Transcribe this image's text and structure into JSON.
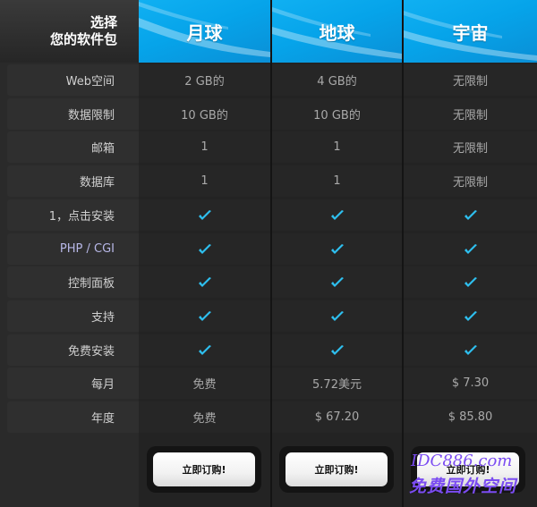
{
  "header": {
    "title_line1": "选择",
    "title_line2": "您的软件包"
  },
  "plans": [
    {
      "name": "月球"
    },
    {
      "name": "地球"
    },
    {
      "name": "宇宙"
    }
  ],
  "rows": [
    {
      "label": "Web空间",
      "values": [
        "2 GB的",
        "4 GB的",
        "无限制"
      ]
    },
    {
      "label": "数据限制",
      "values": [
        "10 GB的",
        "10 GB的",
        "无限制"
      ]
    },
    {
      "label": "邮箱",
      "values": [
        "1",
        "1",
        "无限制"
      ]
    },
    {
      "label": "数据库",
      "values": [
        "1",
        "1",
        "无限制"
      ]
    },
    {
      "label": "1，点击安装",
      "values": [
        "check",
        "check",
        "check"
      ]
    },
    {
      "label": "PHP / CGI",
      "values": [
        "check",
        "check",
        "check"
      ]
    },
    {
      "label": "控制面板",
      "values": [
        "check",
        "check",
        "check"
      ]
    },
    {
      "label": "支持",
      "values": [
        "check",
        "check",
        "check"
      ]
    },
    {
      "label": "免费安装",
      "values": [
        "check",
        "check",
        "check"
      ]
    },
    {
      "label": "每月",
      "values": [
        "免费",
        "5.72美元",
        "$ 7.30"
      ]
    },
    {
      "label": "年度",
      "values": [
        "免费",
        "$ 67.20",
        "$ 85.80"
      ]
    }
  ],
  "order_buttons": [
    {
      "label": "立即订购!"
    },
    {
      "label": "立即订购!"
    },
    {
      "label": "立即订购!"
    }
  ],
  "watermark": {
    "line1": "IDC886.com",
    "line2": "免费国外空间"
  },
  "colors": {
    "accent_blue": "#06a4ea",
    "check_blue": "#2ec0f0",
    "watermark_purple": "#7b4cf2"
  },
  "icons": {
    "check": "check-icon"
  }
}
